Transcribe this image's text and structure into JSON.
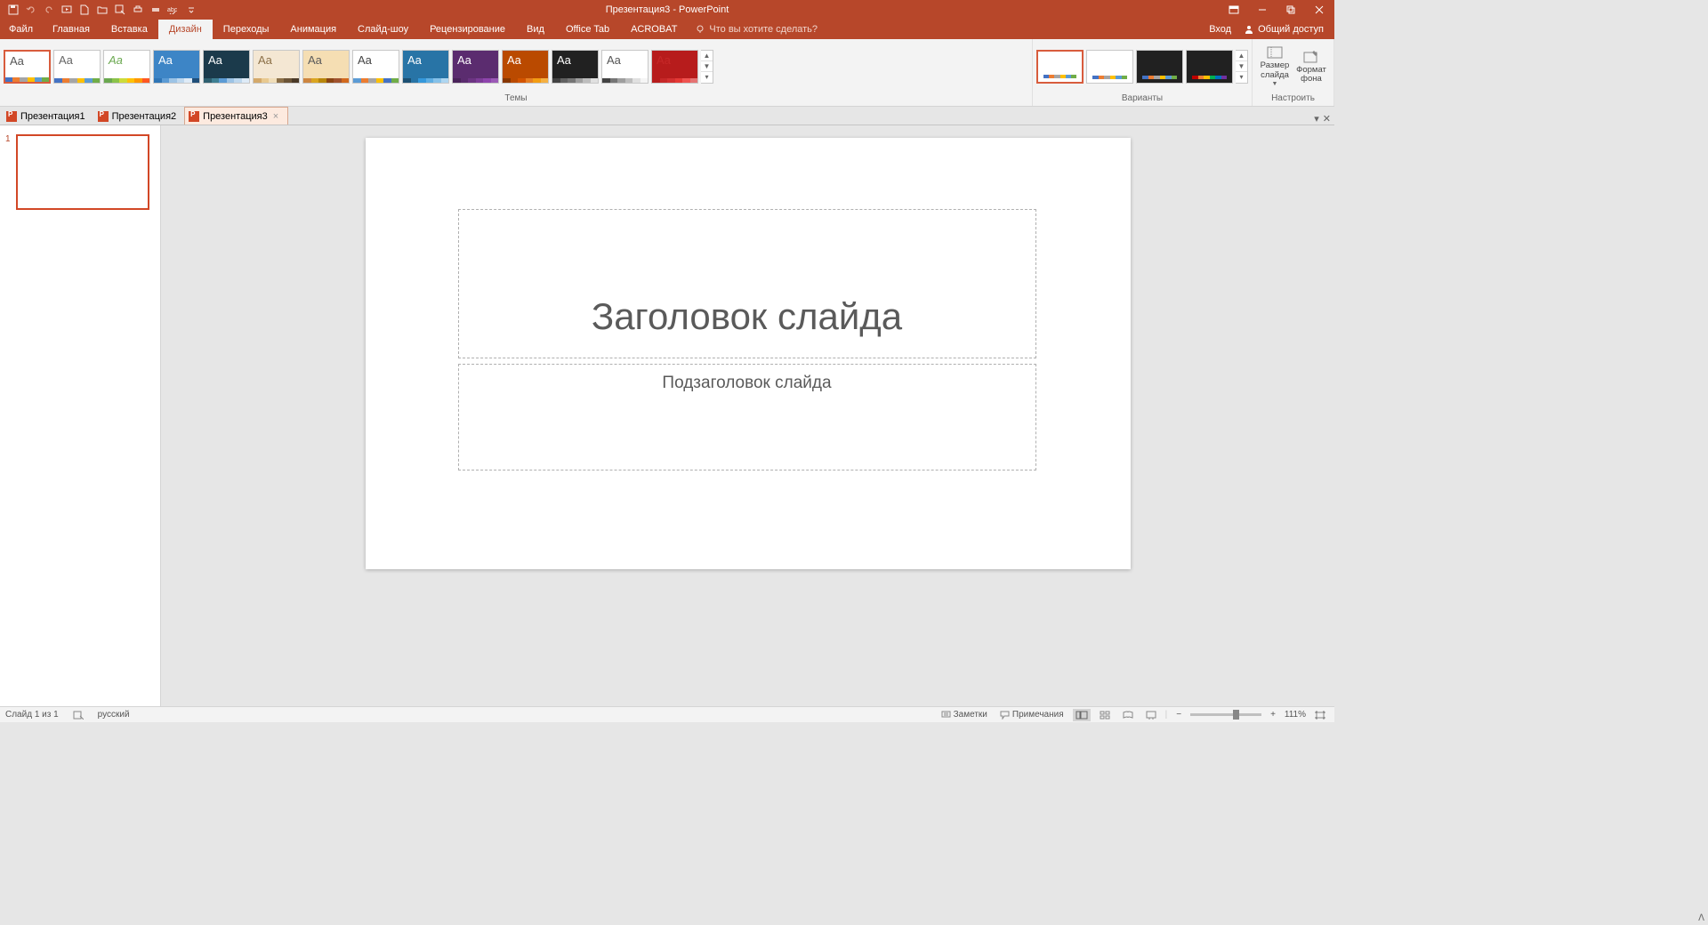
{
  "title": "Презентация3 - PowerPoint",
  "qat_icons": [
    "save",
    "undo",
    "redo",
    "start-from-beginning",
    "new",
    "open",
    "save-as",
    "print-preview",
    "quick-print",
    "spellcheck",
    "more"
  ],
  "ribbon_tabs": {
    "file": "Файл",
    "items": [
      "Главная",
      "Вставка",
      "Дизайн",
      "Переходы",
      "Анимация",
      "Слайд-шоу",
      "Рецензирование",
      "Вид",
      "Office Tab",
      "ACROBAT"
    ],
    "active_index": 2,
    "tellme_placeholder": "Что вы хотите сделать?",
    "signin": "Вход",
    "share": "Общий доступ"
  },
  "ribbon_groups": {
    "themes_label": "Темы",
    "variants_label": "Варианты",
    "customize_label": "Настроить",
    "slide_size": "Размер\nслайда",
    "format_bg": "Формат\nфона"
  },
  "themes": [
    {
      "aa": "Aa",
      "bg": "#ffffff",
      "fg": "#555",
      "colors": [
        "#4472c4",
        "#ed7d31",
        "#a5a5a5",
        "#ffc000",
        "#5b9bd5",
        "#70ad47"
      ],
      "selected": true
    },
    {
      "aa": "Aa",
      "bg": "#ffffff",
      "fg": "#666",
      "colors": [
        "#4472c4",
        "#ed7d31",
        "#a5a5a5",
        "#ffc000",
        "#5b9bd5",
        "#70ad47"
      ]
    },
    {
      "aa": "Aa",
      "bg": "#ffffff",
      "fg": "#6aa84f",
      "colors": [
        "#6aa84f",
        "#8bc34a",
        "#cddc39",
        "#ffc107",
        "#ff9800",
        "#ff5722"
      ],
      "accent": "green"
    },
    {
      "aa": "Aa",
      "bg": "#3d85c6",
      "fg": "#fff",
      "colors": [
        "#2e75b6",
        "#5b9bd5",
        "#9cc3e5",
        "#bdd7ee",
        "#deebf7",
        "#1f4e79"
      ],
      "pattern": true
    },
    {
      "aa": "Aa",
      "bg": "#1b3a4b",
      "fg": "#fff",
      "colors": [
        "#2e5f6f",
        "#3e7f93",
        "#5b9bd5",
        "#9cc3e5",
        "#bdd7ee",
        "#deebf7"
      ]
    },
    {
      "aa": "Aa",
      "bg": "#f4e7d3",
      "fg": "#8b6f47",
      "colors": [
        "#d4a96a",
        "#e8c990",
        "#f0ddb8",
        "#8b6f47",
        "#6b5437",
        "#4a3927"
      ]
    },
    {
      "aa": "Aa",
      "bg": "#f5deb3",
      "fg": "#5a5a5a",
      "colors": [
        "#cd853f",
        "#daa520",
        "#b8860b",
        "#8b4513",
        "#a0522d",
        "#d2691e"
      ],
      "half": true
    },
    {
      "aa": "Aa",
      "bg": "#ffffff",
      "fg": "#444",
      "colors": [
        "#5b9bd5",
        "#ed7d31",
        "#a5a5a5",
        "#ffc000",
        "#4472c4",
        "#70ad47"
      ]
    },
    {
      "aa": "Aa",
      "bg": "#2874a6",
      "fg": "#fff",
      "colors": [
        "#1b4f72",
        "#2874a6",
        "#3498db",
        "#5dade2",
        "#85c1e9",
        "#aed6f1"
      ]
    },
    {
      "aa": "Aa",
      "bg": "#5b2c6f",
      "fg": "#fff",
      "colors": [
        "#4a235a",
        "#5b2c6f",
        "#6c3483",
        "#7d3c98",
        "#8e44ad",
        "#9b59b6"
      ]
    },
    {
      "aa": "Aa",
      "bg": "#ba4a00",
      "fg": "#fff",
      "colors": [
        "#873600",
        "#ba4a00",
        "#d35400",
        "#e67e22",
        "#f39c12",
        "#f5b041"
      ]
    },
    {
      "aa": "Aa",
      "bg": "#212121",
      "fg": "#fff",
      "colors": [
        "#424242",
        "#616161",
        "#757575",
        "#9e9e9e",
        "#bdbdbd",
        "#e0e0e0"
      ]
    },
    {
      "aa": "Aa",
      "bg": "#ffffff",
      "fg": "#555",
      "colors": [
        "#424242",
        "#757575",
        "#9e9e9e",
        "#bdbdbd",
        "#e0e0e0",
        "#f5f5f5"
      ],
      "bottombar": true
    },
    {
      "aa": "Aa",
      "bg": "#b71c1c",
      "fg": "#c62828",
      "colors": [
        "#b71c1c",
        "#c62828",
        "#d32f2f",
        "#e53935",
        "#ef5350",
        "#e57373"
      ],
      "special": true
    }
  ],
  "variants": [
    {
      "bg": "#ffffff",
      "colors": [
        "#4472c4",
        "#ed7d31",
        "#a5a5a5",
        "#ffc000",
        "#5b9bd5",
        "#70ad47"
      ],
      "selected": true
    },
    {
      "bg": "#ffffff",
      "colors": [
        "#4472c4",
        "#ed7d31",
        "#a5a5a5",
        "#ffc000",
        "#5b9bd5",
        "#70ad47"
      ]
    },
    {
      "bg": "#212121",
      "colors": [
        "#4472c4",
        "#ed7d31",
        "#a5a5a5",
        "#ffc000",
        "#5b9bd5",
        "#70ad47"
      ]
    },
    {
      "bg": "#212121",
      "colors": [
        "#c00000",
        "#ed7d31",
        "#ffc000",
        "#00b050",
        "#0070c0",
        "#7030a0"
      ]
    }
  ],
  "doctabs": [
    {
      "name": "Презентация1",
      "active": false
    },
    {
      "name": "Презентация2",
      "active": false
    },
    {
      "name": "Презентация3",
      "active": true
    }
  ],
  "slide_panel": {
    "slides": [
      {
        "num": "1"
      }
    ]
  },
  "slide": {
    "title_placeholder": "Заголовок слайда",
    "subtitle_placeholder": "Подзаголовок слайда"
  },
  "statusbar": {
    "slide_info": "Слайд 1 из 1",
    "language": "русский",
    "notes": "Заметки",
    "comments": "Примечания",
    "zoom": "111%"
  }
}
